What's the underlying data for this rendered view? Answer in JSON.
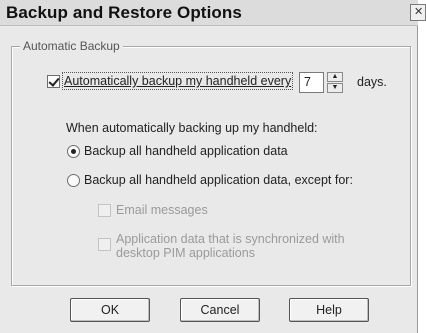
{
  "dialog": {
    "title": "Backup and Restore Options",
    "close_glyph": "✕"
  },
  "group": {
    "label": "Automatic Backup"
  },
  "auto_backup": {
    "checkbox_label": "Automatically backup my handheld every",
    "checked": true,
    "days_value": "7",
    "days_label": "days."
  },
  "when_label": "When automatically backing up my handheld:",
  "options": {
    "backup_all_label": "Backup all handheld application data",
    "backup_except_label": "Backup all handheld application data, except for:",
    "selected": "backup_all"
  },
  "exceptions": {
    "email_label": "Email messages",
    "app_data_line1": "Application data that is synchronized with",
    "app_data_line2": "desktop PIM applications"
  },
  "buttons": {
    "ok": "OK",
    "cancel": "Cancel",
    "help": "Help"
  }
}
